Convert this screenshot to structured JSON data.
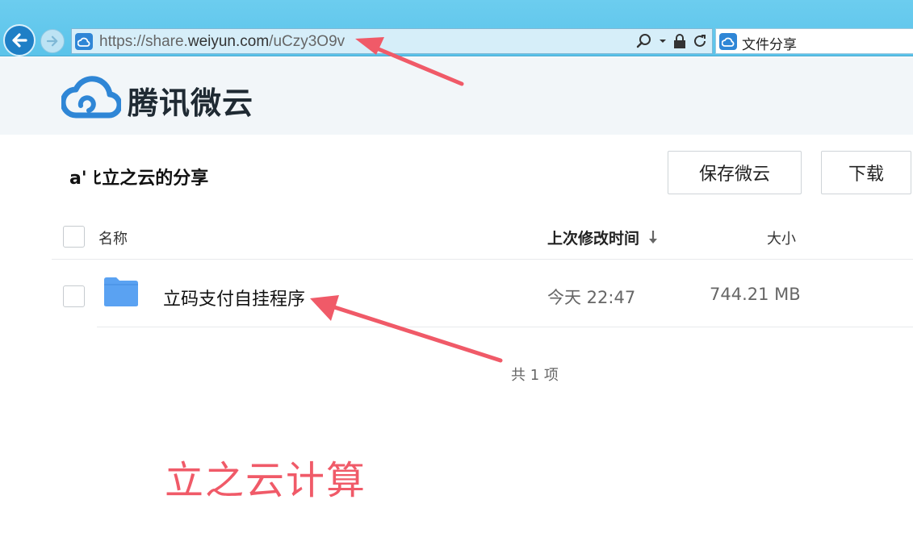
{
  "browser": {
    "url_prefix": "https://share.",
    "url_domain": "weiyun.com",
    "url_path": "/uCzy3O9v",
    "tab_title": "文件分享"
  },
  "site": {
    "brand": "腾讯微云"
  },
  "share": {
    "title": "a' ﾋ立之云的分享",
    "save_label": "保存微云",
    "download_label": "下载"
  },
  "table": {
    "columns": {
      "name": "名称",
      "modified": "上次修改时间",
      "size": "大小"
    },
    "rows": [
      {
        "name": "立码支付自挂程序",
        "modified": "今天 22:47",
        "size": "744.21 MB"
      }
    ]
  },
  "footer": {
    "count": "共 1 项"
  },
  "watermark": "立之云计算",
  "colors": {
    "accent": "#2f86d6",
    "annotation": "#f05a68",
    "folder": "#5aa2f2"
  }
}
